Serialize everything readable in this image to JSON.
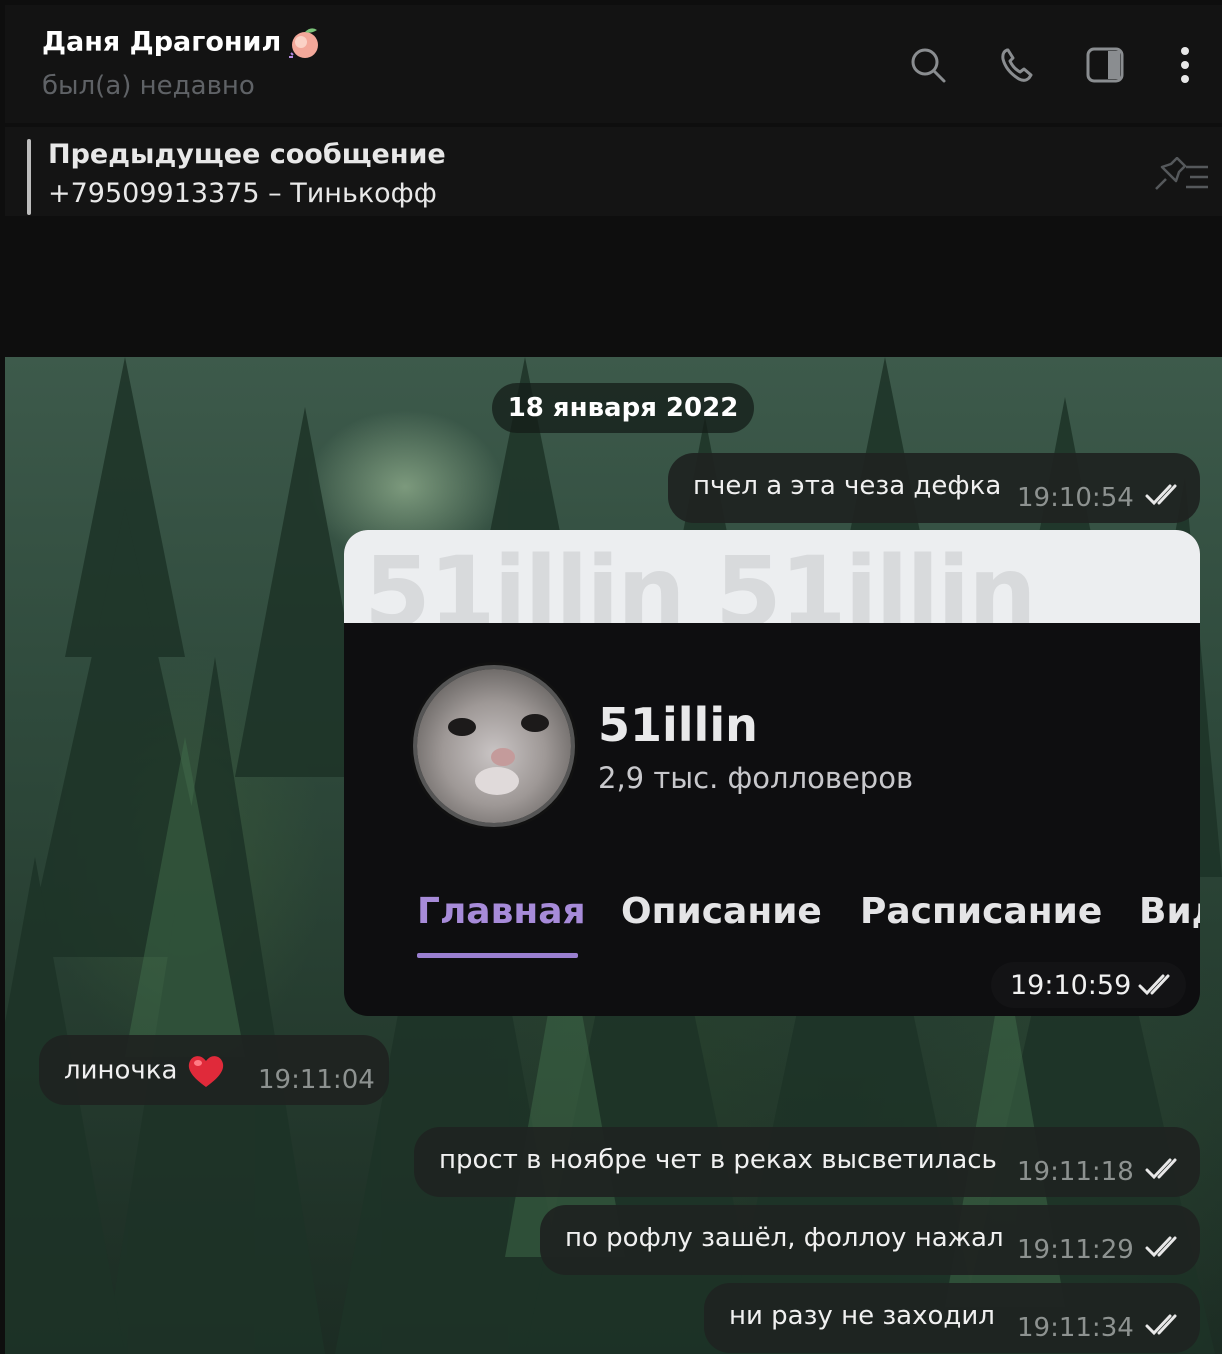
{
  "header": {
    "title": "Даня Драгонил",
    "status": "был(а) недавно"
  },
  "pinned": {
    "title": "Предыдущее сообщение",
    "text": "+79509913375 – Тинькофф"
  },
  "date_separator": "18 января 2022",
  "messages": [
    {
      "text": "пчел а эта чеза дефка",
      "time": "19:10:54",
      "outgoing": true
    },
    {
      "time": "19:10:59",
      "outgoing": true,
      "image": {
        "banner": "51illin 51illin",
        "username": "51illin",
        "followers": "2,9 тыс. фолловеров",
        "tabs": [
          "Главная",
          "Описание",
          "Расписание",
          "Вид"
        ]
      }
    },
    {
      "text": "линочка",
      "time": "19:11:04",
      "outgoing": false
    },
    {
      "text": "прост в ноябре чет в реках высветилась",
      "time": "19:11:18",
      "outgoing": true
    },
    {
      "text": "по рофлу зашёл, фоллоу нажал",
      "time": "19:11:29",
      "outgoing": true
    },
    {
      "text": "ни разу не заходил",
      "time": "19:11:34",
      "outgoing": true
    }
  ],
  "icons": [
    "peach-emoji-icon",
    "search-icon",
    "phone-icon",
    "sidebar-toggle-icon",
    "more-vertical-icon",
    "pinned-list-icon",
    "heart-emoji-icon",
    "double-check-icon"
  ],
  "colors": {
    "tab_active": "#a78bd9",
    "bubble": "#1f2321"
  }
}
